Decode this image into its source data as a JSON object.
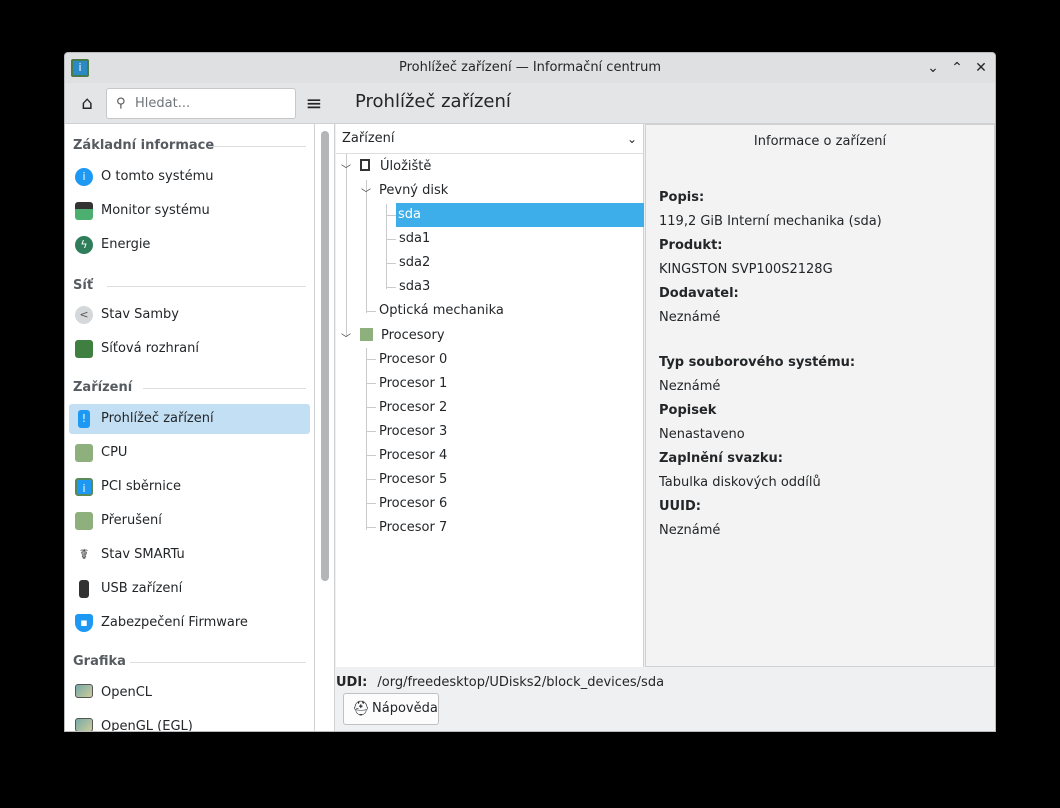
{
  "window": {
    "title": "Prohlížeč zařízení — Informační centrum"
  },
  "header": {
    "search_placeholder": "Hledat...",
    "page_title": "Prohlížeč zařízení"
  },
  "sidebar": {
    "sections": [
      {
        "label": "Základní informace",
        "items": [
          {
            "label": "O tomto systému",
            "icon": "info-icon"
          },
          {
            "label": "Monitor systému",
            "icon": "monitor-chart-icon"
          },
          {
            "label": "Energie",
            "icon": "energy-icon"
          }
        ]
      },
      {
        "label": "Síť",
        "items": [
          {
            "label": "Stav Samby",
            "icon": "share-icon"
          },
          {
            "label": "Síťová rozhraní",
            "icon": "network-card-icon"
          }
        ]
      },
      {
        "label": "Zařízení",
        "items": [
          {
            "label": "Prohlížeč zařízení",
            "icon": "device-info-icon",
            "selected": true
          },
          {
            "label": "CPU",
            "icon": "cpu-icon"
          },
          {
            "label": "PCI sběrnice",
            "icon": "pci-icon"
          },
          {
            "label": "Přerušení",
            "icon": "interrupt-icon"
          },
          {
            "label": "Stav SMARTu",
            "icon": "smart-icon"
          },
          {
            "label": "USB zařízení",
            "icon": "usb-icon"
          },
          {
            "label": "Zabezpečení Firmware",
            "icon": "shield-lock-icon"
          }
        ]
      },
      {
        "label": "Grafika",
        "items": [
          {
            "label": "OpenCL",
            "icon": "display-icon"
          },
          {
            "label": "OpenGL (EGL)",
            "icon": "display-icon"
          }
        ]
      }
    ]
  },
  "tree": {
    "header": "Zařízení",
    "storage": "Úložiště",
    "hdd": "Pevný disk",
    "sda": "sda",
    "sda1": "sda1",
    "sda2": "sda2",
    "sda3": "sda3",
    "optical": "Optická mechanika",
    "processors": "Procesory",
    "cpus": [
      "Procesor 0",
      "Procesor 1",
      "Procesor 2",
      "Procesor 3",
      "Procesor 4",
      "Procesor 5",
      "Procesor 6",
      "Procesor 7"
    ]
  },
  "info": {
    "title": "Informace o zařízení",
    "rows": [
      {
        "label": "Popis:",
        "value": "119,2 GiB Interní mechanika (sda)"
      },
      {
        "label": "Produkt:",
        "value": "KINGSTON SVP100S2128G"
      },
      {
        "label": "Dodavatel:",
        "value": "Neznámé"
      },
      {
        "label": "Typ souborového systému:",
        "value": "Neznámé"
      },
      {
        "label": "Popisek",
        "value": "Nenastaveno"
      },
      {
        "label": "Zaplnění svazku:",
        "value": "Tabulka diskových oddílů"
      },
      {
        "label": "UUID:",
        "value": "Neznámé"
      }
    ]
  },
  "footer": {
    "udi_label": "UDI:",
    "udi_value": "/org/freedesktop/UDisks2/block_devices/sda",
    "help_label": "Nápověda"
  }
}
